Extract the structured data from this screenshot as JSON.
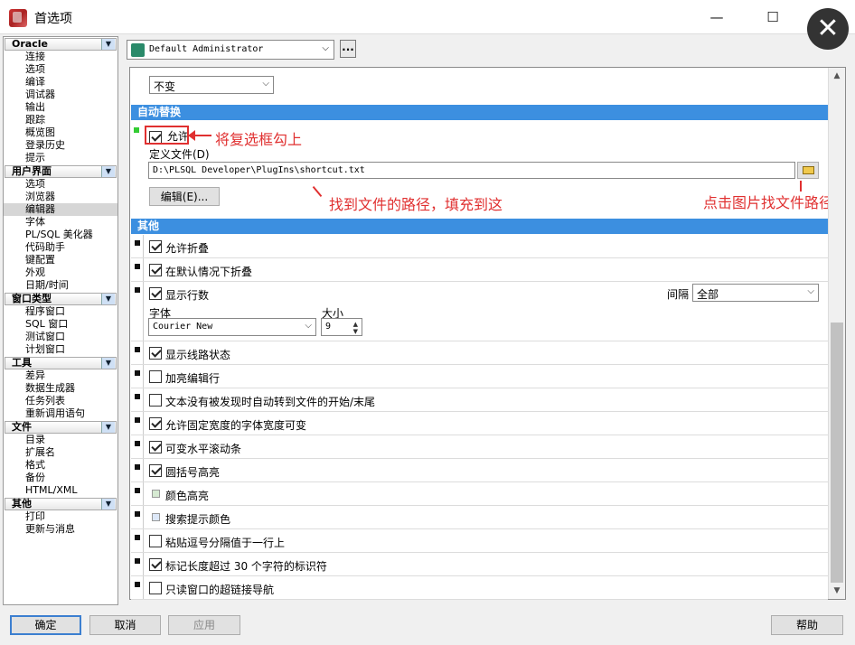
{
  "window": {
    "title": "首选项",
    "controls": {
      "minimize": "—",
      "maximize": "☐",
      "close": "✕"
    }
  },
  "nav": [
    {
      "category": "Oracle",
      "items": [
        "连接",
        "选项",
        "编译",
        "调试器",
        "输出",
        "跟踪",
        "概览图",
        "登录历史",
        "提示"
      ]
    },
    {
      "category": "用户界面",
      "items": [
        "选项",
        "浏览器",
        "编辑器",
        "字体",
        "PL/SQL 美化器",
        "代码助手",
        "键配置",
        "外观",
        "日期/时间"
      ],
      "selected": "编辑器"
    },
    {
      "category": "窗口类型",
      "items": [
        "程序窗口",
        "SQL 窗口",
        "测试窗口",
        "计划窗口"
      ]
    },
    {
      "category": "工具",
      "items": [
        "差异",
        "数据生成器",
        "任务列表",
        "重新调用语句"
      ]
    },
    {
      "category": "文件",
      "items": [
        "目录",
        "扩展名",
        "格式",
        "备份",
        "HTML/XML"
      ]
    },
    {
      "category": "其他",
      "items": [
        "打印",
        "更新与消息"
      ]
    }
  ],
  "profile": {
    "selected": "Default Administrator",
    "more_label": "..."
  },
  "top_combo": {
    "value": "不变"
  },
  "autoreplace": {
    "header": "自动替换",
    "allow_label": "允许",
    "allow_checked": true,
    "file_label": "定义文件(D)",
    "file_path": "D:\\PLSQL Developer\\PlugIns\\shortcut.txt",
    "edit_button": "编辑(E)..."
  },
  "other": {
    "header": "其他",
    "options": [
      {
        "label": "允许折叠",
        "checked": true,
        "type": "check"
      },
      {
        "label": "在默认情况下折叠",
        "checked": true,
        "type": "check"
      },
      {
        "label": "显示行数",
        "checked": true,
        "type": "check"
      },
      {
        "label": "显示线路状态",
        "checked": true,
        "type": "check"
      },
      {
        "label": "加亮编辑行",
        "checked": false,
        "type": "check"
      },
      {
        "label": "文本没有被发现时自动转到文件的开始/末尾",
        "checked": false,
        "type": "check"
      },
      {
        "label": "允许固定宽度的字体宽度可变",
        "checked": true,
        "type": "check"
      },
      {
        "label": "可变水平滚动条",
        "checked": true,
        "type": "check"
      },
      {
        "label": "圆括号高亮",
        "checked": true,
        "type": "check"
      },
      {
        "label": "颜色高亮",
        "type": "color",
        "color": "#d6ead2"
      },
      {
        "label": "搜索提示颜色",
        "type": "color",
        "color": "#dde8f8"
      },
      {
        "label": "粘贴逗号分隔值于一行上",
        "checked": false,
        "type": "check"
      },
      {
        "label": "标记长度超过 30 个字符的标识符",
        "checked": true,
        "type": "check"
      },
      {
        "label": "只读窗口的超链接导航",
        "checked": false,
        "type": "check"
      }
    ],
    "line_numbers": {
      "interval_label": "间隔",
      "interval_value": "全部",
      "font_label": "字体",
      "font_value": "Courier New",
      "size_label": "大小",
      "size_value": "9"
    }
  },
  "annotations": {
    "check_hint": "将复选框勾上",
    "path_hint": "找到文件的路径，填充到这",
    "browse_hint": "点击图片找文件路径"
  },
  "buttons": {
    "ok": "确定",
    "cancel": "取消",
    "apply": "应用",
    "help": "帮助"
  },
  "colors": {
    "section_header": "#3c8fe0",
    "annotation": "#e03030",
    "primary_border": "#3c7fd0"
  }
}
